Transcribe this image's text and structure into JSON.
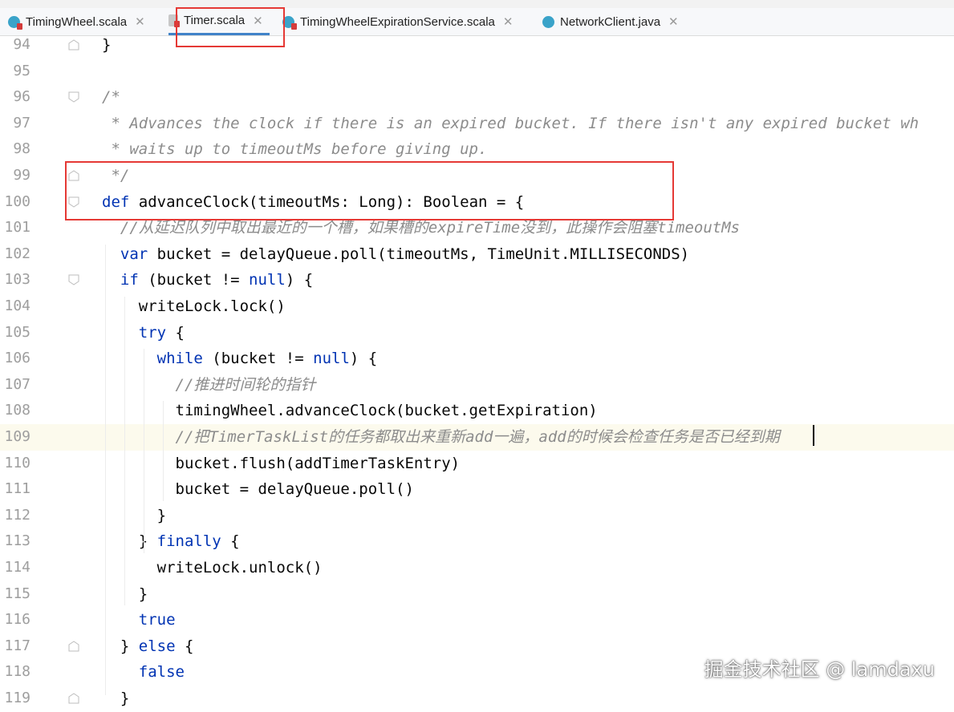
{
  "tabs": [
    {
      "label": "TimingWheel.scala",
      "icon": "scala-class-icon",
      "active": false
    },
    {
      "label": "Timer.scala",
      "icon": "scala-file-icon",
      "active": true
    },
    {
      "label": "TimingWheelExpirationService.scala",
      "icon": "scala-class-icon",
      "active": false
    },
    {
      "label": "NetworkClient.java",
      "icon": "java-class-icon",
      "active": false
    }
  ],
  "lines": [
    {
      "n": "94",
      "parts": [
        [
          "",
          "}"
        ]
      ]
    },
    {
      "n": "95",
      "parts": []
    },
    {
      "n": "96",
      "parts": [
        [
          "cm",
          "/*"
        ]
      ]
    },
    {
      "n": "97",
      "parts": [
        [
          "cm",
          " * Advances the clock if there is an expired bucket. If there isn't any expired bucket wh"
        ]
      ]
    },
    {
      "n": "98",
      "parts": [
        [
          "cm",
          " * waits up to timeoutMs before giving up."
        ]
      ]
    },
    {
      "n": "99",
      "parts": [
        [
          "cm",
          " */"
        ]
      ]
    },
    {
      "n": "100",
      "parts": [
        [
          "kw",
          "def "
        ],
        [
          "",
          "advanceClock(timeoutMs: Long): Boolean = {"
        ]
      ]
    },
    {
      "n": "101",
      "parts": [
        [
          "cm",
          "  //从延迟队列中取出最近的一个槽，如果槽的expireTime没到，此操作会阻塞timeoutMs"
        ]
      ]
    },
    {
      "n": "102",
      "parts": [
        [
          "kw",
          "  var "
        ],
        [
          "",
          "bucket = delayQueue.poll(timeoutMs, TimeUnit.MILLISECONDS)"
        ]
      ]
    },
    {
      "n": "103",
      "parts": [
        [
          "kw",
          "  if "
        ],
        [
          "",
          "(bucket != "
        ],
        [
          "kw",
          "null"
        ],
        [
          "",
          ") {"
        ]
      ]
    },
    {
      "n": "104",
      "parts": [
        [
          "",
          "    writeLock.lock()"
        ]
      ]
    },
    {
      "n": "105",
      "parts": [
        [
          "kw",
          "    try "
        ],
        [
          "",
          "{"
        ]
      ]
    },
    {
      "n": "106",
      "parts": [
        [
          "kw",
          "      while "
        ],
        [
          "",
          "(bucket != "
        ],
        [
          "kw",
          "null"
        ],
        [
          "",
          ") {"
        ]
      ]
    },
    {
      "n": "107",
      "parts": [
        [
          "cm",
          "        //推进时间轮的指针"
        ]
      ]
    },
    {
      "n": "108",
      "parts": [
        [
          "",
          "        timingWheel.advanceClock(bucket.getExpiration)"
        ]
      ]
    },
    {
      "n": "109",
      "parts": [
        [
          "cm",
          "        //把TimerTaskList的任务都取出来重新add一遍，add的时候会检查任务是否已经到期"
        ]
      ]
    },
    {
      "n": "110",
      "parts": [
        [
          "",
          "        bucket.flush(addTimerTaskEntry)"
        ]
      ]
    },
    {
      "n": "111",
      "parts": [
        [
          "",
          "        bucket = delayQueue.poll()"
        ]
      ]
    },
    {
      "n": "112",
      "parts": [
        [
          "",
          "      }"
        ]
      ]
    },
    {
      "n": "113",
      "parts": [
        [
          "",
          "    } "
        ],
        [
          "kw",
          "finally "
        ],
        [
          "",
          "{"
        ]
      ]
    },
    {
      "n": "114",
      "parts": [
        [
          "",
          "      writeLock.unlock()"
        ]
      ]
    },
    {
      "n": "115",
      "parts": [
        [
          "",
          "    }"
        ]
      ]
    },
    {
      "n": "116",
      "parts": [
        [
          "kw",
          "    true"
        ]
      ]
    },
    {
      "n": "117",
      "parts": [
        [
          "",
          "  } "
        ],
        [
          "kw",
          "else "
        ],
        [
          "",
          "{"
        ]
      ]
    },
    {
      "n": "118",
      "parts": [
        [
          "kw",
          "    false"
        ]
      ]
    },
    {
      "n": "119",
      "parts": [
        [
          "",
          "  }"
        ]
      ]
    }
  ],
  "current_line": "109",
  "colors": {
    "keyword": "#0033b3",
    "comment": "#8c8c8c",
    "highlight_box": "#e53935",
    "active_tab_underline": "#4083c9"
  },
  "watermark": "掘金技术社区 @ lamdaxu"
}
